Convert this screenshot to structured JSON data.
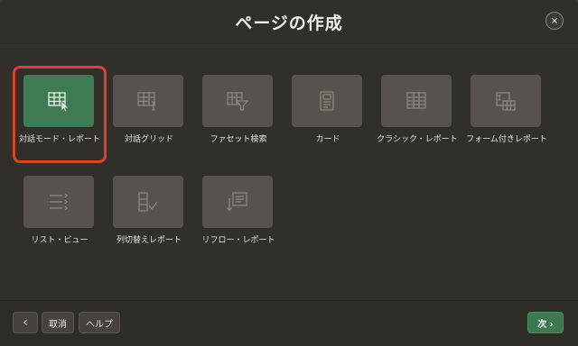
{
  "dialog": {
    "title": "ページの作成",
    "close_symbol": "✕"
  },
  "tiles": [
    {
      "label": "対話モード・レポート",
      "icon": "interactive-report-icon",
      "selected": true
    },
    {
      "label": "対話グリッド",
      "icon": "interactive-grid-icon",
      "selected": false
    },
    {
      "label": "ファセット検索",
      "icon": "faceted-search-icon",
      "selected": false
    },
    {
      "label": "カード",
      "icon": "cards-icon",
      "selected": false
    },
    {
      "label": "クラシック・レポート",
      "icon": "classic-report-icon",
      "selected": false
    },
    {
      "label": "フォーム付きレポート",
      "icon": "report-with-form-icon",
      "selected": false
    },
    {
      "label": "リスト・ビュー",
      "icon": "list-view-icon",
      "selected": false
    },
    {
      "label": "列切替えレポート",
      "icon": "column-toggle-report-icon",
      "selected": false
    },
    {
      "label": "リフロー・レポート",
      "icon": "reflow-report-icon",
      "selected": false
    }
  ],
  "footer": {
    "back_symbol": "‹",
    "cancel_label": "取消",
    "help_label": "ヘルプ",
    "next_label": "次 ›"
  },
  "colors": {
    "accent_green": "#3e7a52",
    "selection_ring": "#d8442a",
    "tile_bg": "#57524d"
  }
}
